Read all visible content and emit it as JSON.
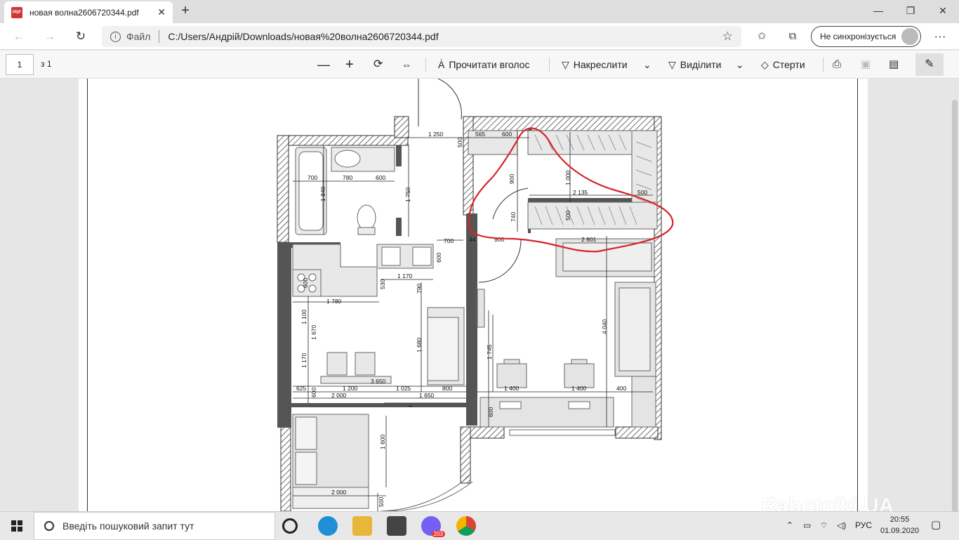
{
  "browser": {
    "tab_title": "новая волна2606720344.pdf",
    "tab_close": "✕",
    "new_tab": "+",
    "minimize": "—",
    "maximize": "❐",
    "close": "✕",
    "back": "←",
    "forward": "→",
    "refresh": "↻",
    "scheme_label": "Файл",
    "url": "C:/Users/Андрій/Downloads/новая%20волна2606720344.pdf",
    "favorite_star": "☆",
    "sync_label": "Не синхронізується",
    "more": "···"
  },
  "pdf_toolbar": {
    "page_number": "1",
    "page_of": "з 1",
    "zoom_out": "—",
    "zoom_in": "+",
    "read_aloud": "Прочитати вголос",
    "draw": "Накреслити",
    "highlight": "Виділити",
    "erase": "Стерти"
  },
  "plan": {
    "dims": [
      "1 250",
      "565",
      "600",
      "500",
      "700",
      "780",
      "600",
      "1 840",
      "1 750",
      "900",
      "1 000",
      "2 135",
      "500",
      "740",
      "500",
      "700",
      "900",
      "2 801",
      "600",
      "1 170",
      "530",
      "790",
      "600",
      "1 780",
      "1 100",
      "1 670",
      "1 170",
      "1 680",
      "4 040",
      "1 745",
      "3 650",
      "625",
      "600",
      "1 200",
      "1 025",
      "800",
      "1 400",
      "1 400",
      "400",
      "2 000",
      "1 650",
      "600",
      "1 600",
      "2 000",
      "500",
      "44"
    ]
  },
  "watermark": "Rabotniki.UA",
  "taskbar": {
    "search_placeholder": "Введіть пошуковий запит тут",
    "viber_badge": "203",
    "language": "РУС",
    "time": "20:55",
    "date": "01.09.2020"
  },
  "colors": {
    "annotation_red": "#d8232a",
    "wall_gray": "#555555",
    "furniture_gray": "#d9d9d9"
  }
}
